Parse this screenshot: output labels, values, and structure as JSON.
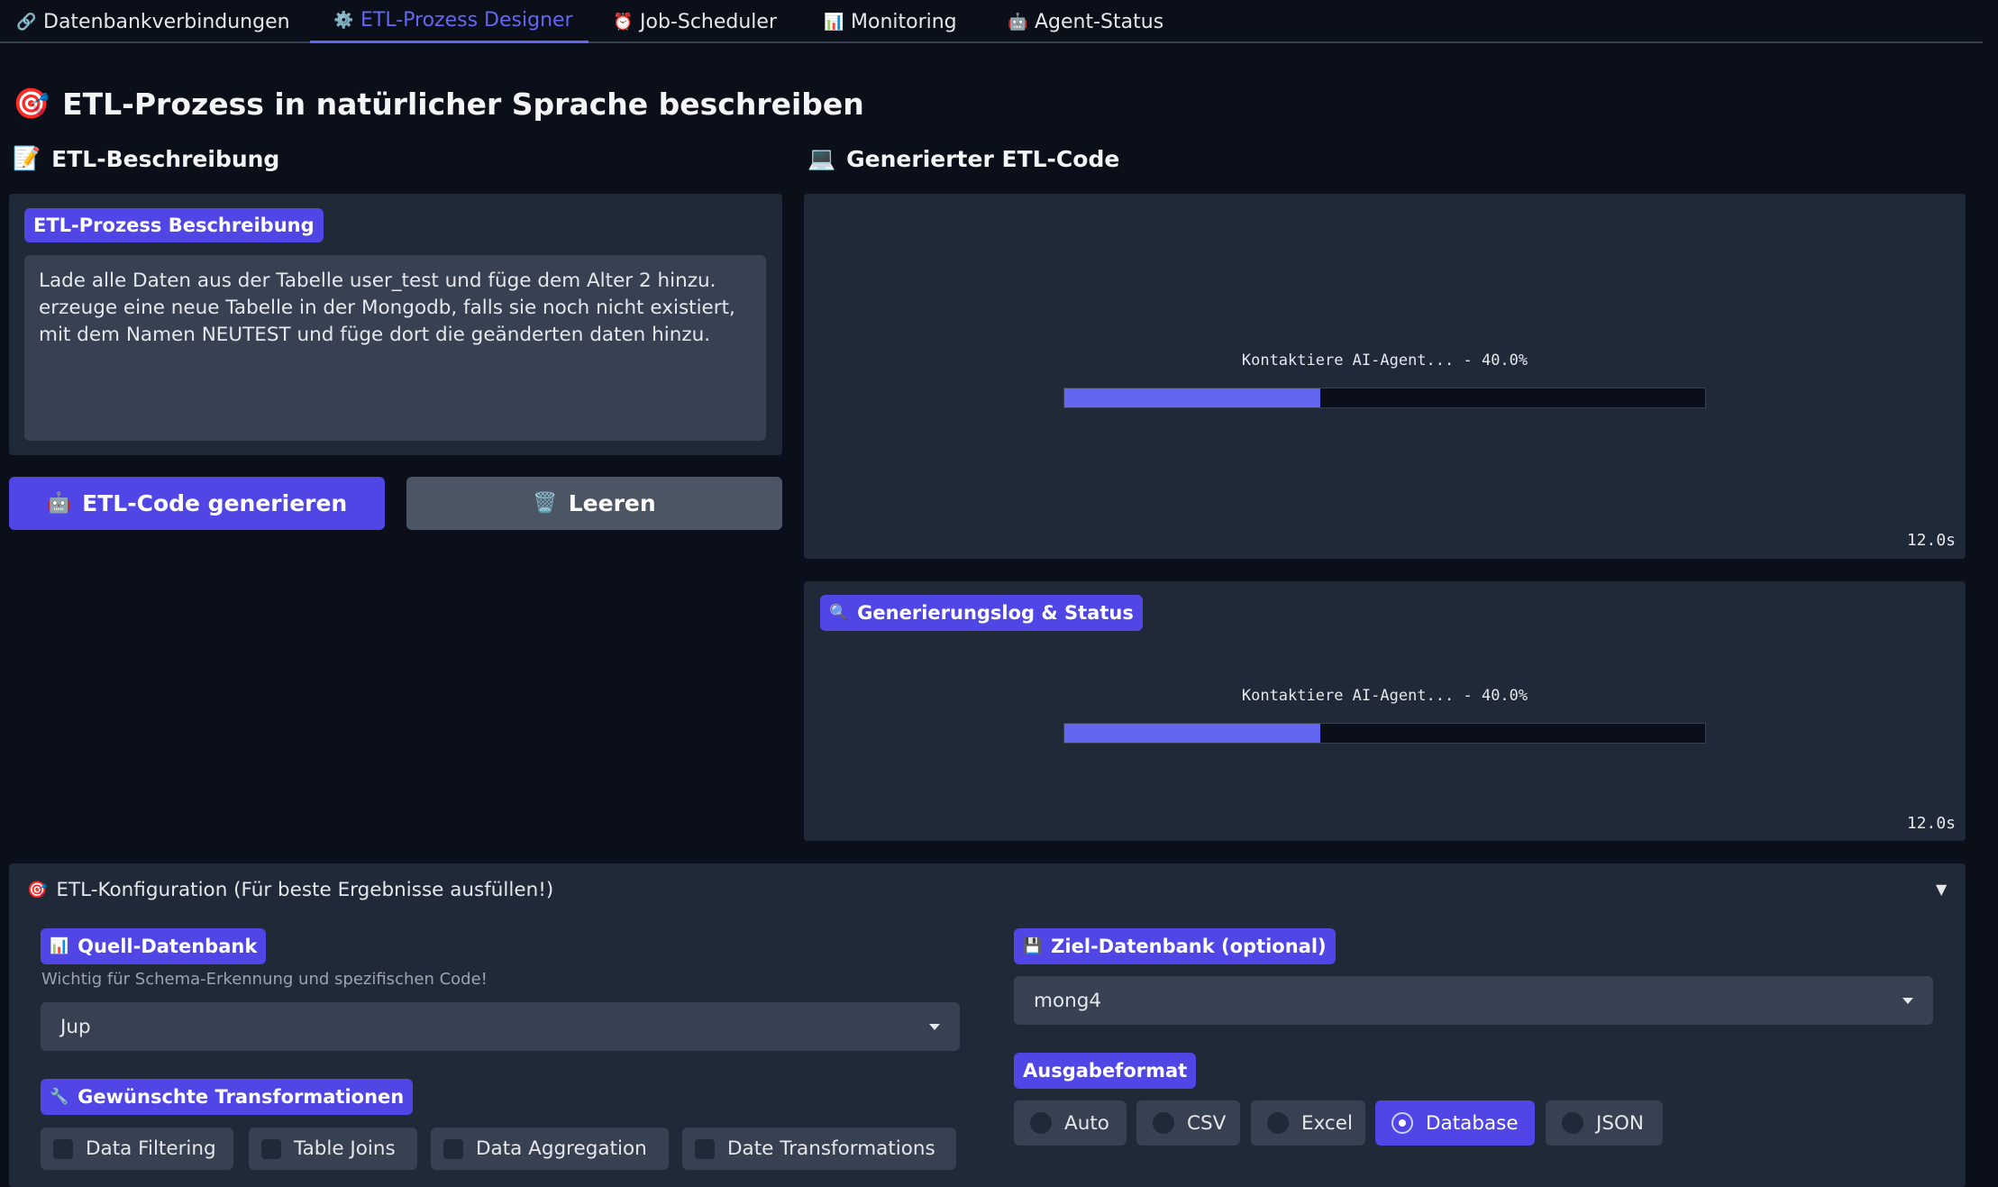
{
  "tabs": [
    {
      "label": "Datenbankverbindungen",
      "icon": "🔗"
    },
    {
      "label": "ETL-Prozess Designer",
      "icon": "⚙️"
    },
    {
      "label": "Job-Scheduler",
      "icon": "⏰"
    },
    {
      "label": "Monitoring",
      "icon": "📊"
    },
    {
      "label": "Agent-Status",
      "icon": "🤖"
    }
  ],
  "active_tab": "ETL-Prozess Designer",
  "page_title": {
    "icon": "🎯",
    "text": "ETL-Prozess in natürlicher Sprache beschreiben"
  },
  "left": {
    "heading": {
      "icon": "📝",
      "text": "ETL-Beschreibung"
    },
    "field_label": "ETL-Prozess Beschreibung",
    "description": "Lade alle Daten aus der Tabelle user_test und füge dem Alter 2 hinzu.\nerzeuge eine neue Tabelle in der Mongodb, falls sie noch nicht existiert,\nmit dem Namen NEUTEST und füge dort die geänderten daten hinzu.",
    "generate_button": {
      "icon": "🤖",
      "label": "ETL-Code generieren"
    },
    "clear_button": {
      "icon": "🗑️",
      "label": "Leeren"
    }
  },
  "right": {
    "heading": {
      "icon": "💻",
      "text": "Generierter ETL-Code"
    },
    "code_progress": {
      "text": "Kontaktiere AI-Agent... - 40.0%",
      "percent": 40,
      "timer": "12.0s"
    },
    "log_label": {
      "icon": "🔍",
      "text": "Generierungslog & Status"
    },
    "log_progress": {
      "text": "Kontaktiere AI-Agent... - 40.0%",
      "percent": 40,
      "timer": "12.0s"
    }
  },
  "config": {
    "title": {
      "icon": "🎯",
      "text": "ETL-Konfiguration (Für beste Ergebnisse ausfüllen!)"
    },
    "toggle_icon": "▼",
    "source": {
      "icon": "📊",
      "label": "Quell-Datenbank",
      "hint": "Wichtig für Schema-Erkennung und spezifischen Code!",
      "value": "Jup"
    },
    "target": {
      "icon": "💾",
      "label": "Ziel-Datenbank (optional)",
      "value": "mong4"
    },
    "transformations": {
      "icon": "🔧",
      "label": "Gewünschte Transformationen",
      "options": [
        "Data Filtering",
        "Table Joins",
        "Data Aggregation",
        "Date Transformations"
      ]
    },
    "output_format": {
      "label": "Ausgabeformat",
      "options": [
        "Auto",
        "CSV",
        "Excel",
        "Database",
        "JSON"
      ],
      "selected": "Database"
    }
  },
  "colors": {
    "accent": "#4f46e5",
    "background": "#0b0f19",
    "panel": "#1f2937",
    "input": "#374151"
  }
}
